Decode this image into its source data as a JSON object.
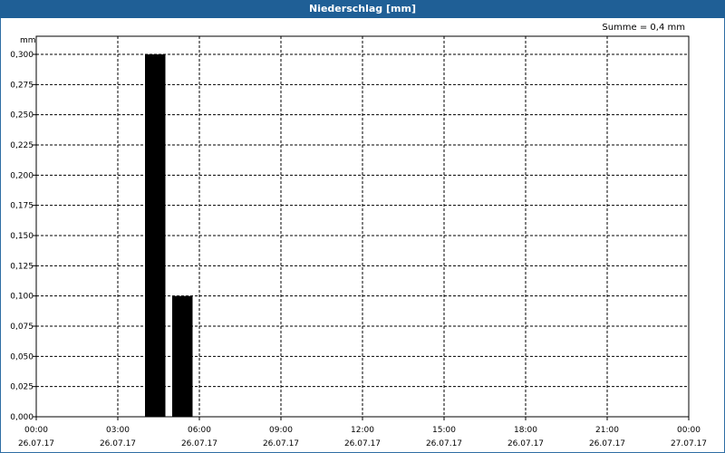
{
  "window": {
    "title": "Niederschlag [mm]"
  },
  "summary": {
    "text": "Summe = 0,4 mm"
  },
  "chart_data": {
    "type": "bar",
    "title": "Niederschlag [mm]",
    "ylabel": "mm",
    "ylim": [
      0,
      0.3
    ],
    "yticks": [
      "0,000",
      "0,025",
      "0,050",
      "0,075",
      "0,100",
      "0,125",
      "0,150",
      "0,175",
      "0,200",
      "0,225",
      "0,250",
      "0,275",
      "0,300"
    ],
    "xlim_hours": [
      0,
      24
    ],
    "xticks": [
      {
        "time": "00:00",
        "date": "26.07.17"
      },
      {
        "time": "03:00",
        "date": "26.07.17"
      },
      {
        "time": "06:00",
        "date": "26.07.17"
      },
      {
        "time": "09:00",
        "date": "26.07.17"
      },
      {
        "time": "12:00",
        "date": "26.07.17"
      },
      {
        "time": "15:00",
        "date": "26.07.17"
      },
      {
        "time": "18:00",
        "date": "26.07.17"
      },
      {
        "time": "21:00",
        "date": "26.07.17"
      },
      {
        "time": "00:00",
        "date": "27.07.17"
      }
    ],
    "bars": [
      {
        "start": "04:00",
        "end": "04:45",
        "value": 0.3
      },
      {
        "start": "05:00",
        "end": "05:45",
        "value": 0.1
      }
    ],
    "grid": true,
    "bar_color": "#000000"
  }
}
